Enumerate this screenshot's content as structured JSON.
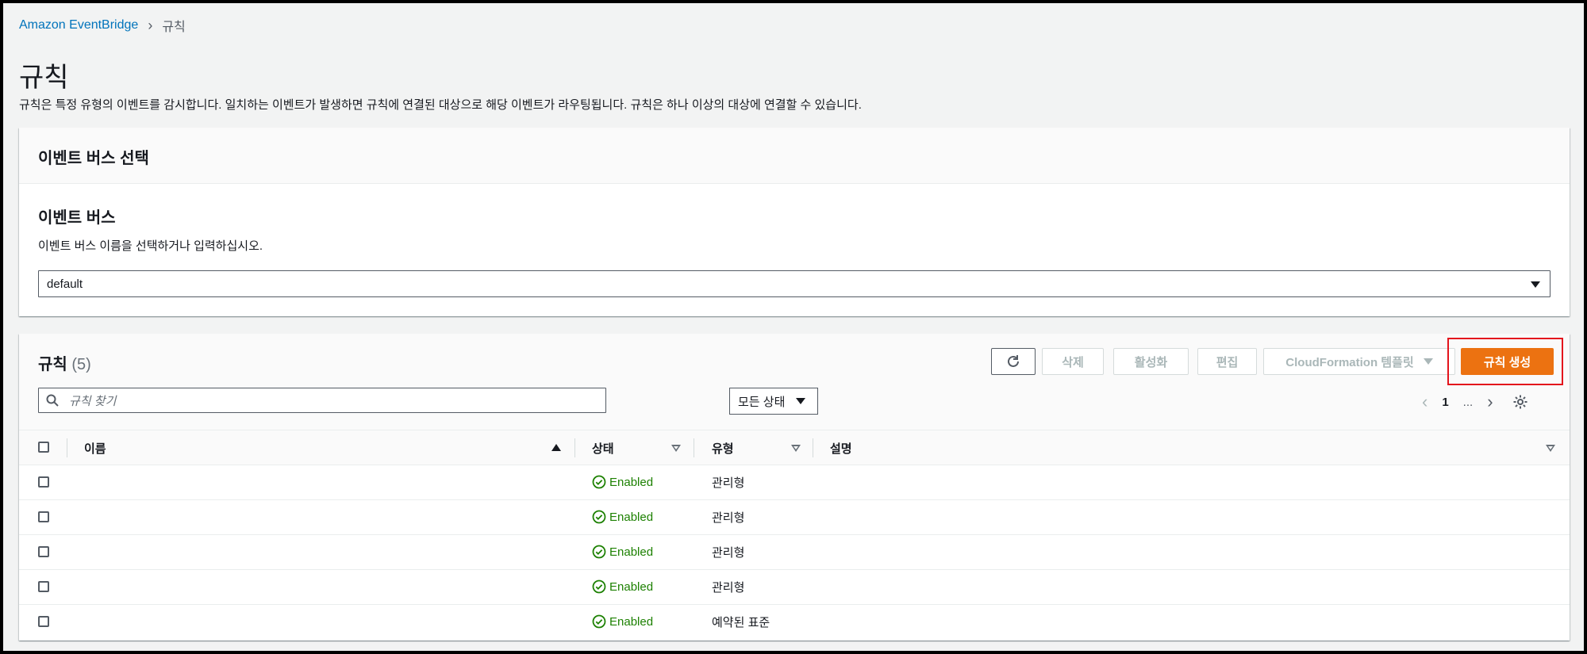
{
  "breadcrumb": {
    "parent": "Amazon EventBridge",
    "current": "규칙"
  },
  "page": {
    "title": "규칙",
    "description": "규칙은 특정 유형의 이벤트를 감시합니다. 일치하는 이벤트가 발생하면 규칙에 연결된 대상으로 해당 이벤트가 라우팅됩니다. 규칙은 하나 이상의 대상에 연결할 수 있습니다."
  },
  "event_bus_panel": {
    "header": "이벤트 버스 선택",
    "label": "이벤트 버스",
    "hint": "이벤트 버스 이름을 선택하거나 입력하십시오.",
    "selected_value": "default"
  },
  "rules_panel": {
    "title": "규칙",
    "count": "(5)",
    "buttons": {
      "delete": "삭제",
      "enable": "활성화",
      "edit": "편집",
      "cloudformation": "CloudFormation 템플릿",
      "create": "규칙 생성"
    },
    "search_placeholder": "규칙 찾기",
    "status_filter": "모든 상태",
    "pagination": {
      "current_page": "1",
      "ellipsis": "..."
    },
    "columns": {
      "name": "이름",
      "status": "상태",
      "type": "유형",
      "description": "설명"
    },
    "rows": [
      {
        "status": "Enabled",
        "type": "관리형"
      },
      {
        "status": "Enabled",
        "type": "관리형"
      },
      {
        "status": "Enabled",
        "type": "관리형"
      },
      {
        "status": "Enabled",
        "type": "관리형"
      },
      {
        "status": "Enabled",
        "type": "예약된 표준"
      }
    ]
  },
  "colors": {
    "link": "#0073bb",
    "primary_button": "#ec7211",
    "success": "#1d8102",
    "highlight": "#e3141c"
  },
  "icons": {
    "refresh": "refresh-icon",
    "search": "search-icon",
    "settings": "gear-icon",
    "status_ok": "check-circle-icon"
  }
}
